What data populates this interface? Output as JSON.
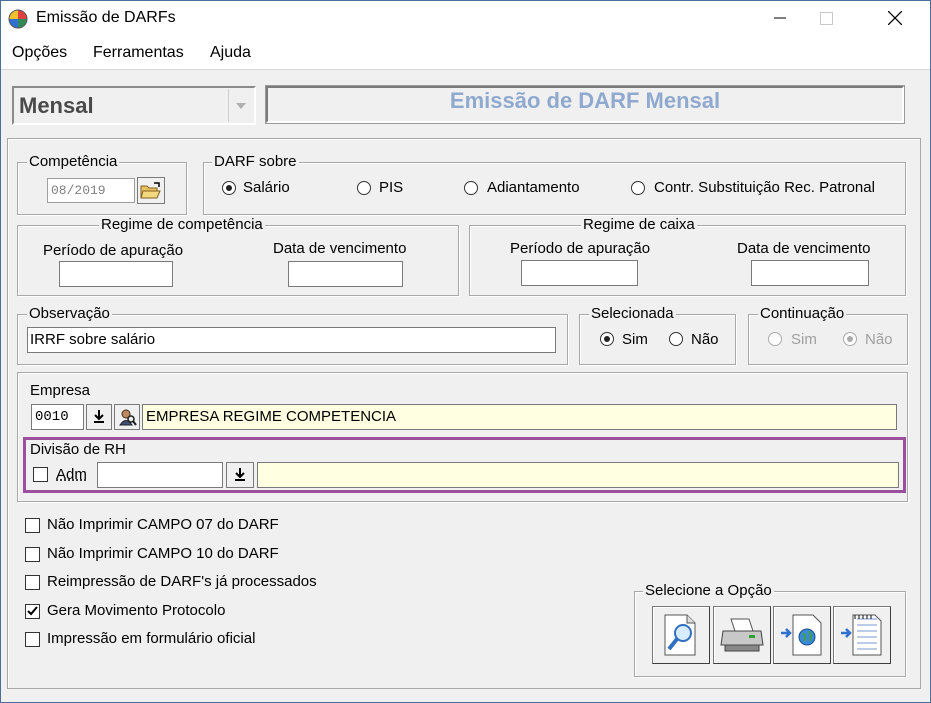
{
  "window": {
    "title": "Emissão de DARFs",
    "minimize_icon": "minimize-icon",
    "maximize_icon": "maximize-icon",
    "close_icon": "close-icon"
  },
  "menu": [
    "Opções",
    "Ferramentas",
    "Ajuda"
  ],
  "header": {
    "type_value": "Mensal",
    "title": "Emissão de DARF Mensal"
  },
  "competencia": {
    "label": "Competência",
    "value": "08/2019"
  },
  "darf_sobre": {
    "label": "DARF sobre",
    "options": [
      "Salário",
      "PIS",
      "Adiantamento",
      "Contr. Substituição Rec. Patronal"
    ],
    "selected": "Salário"
  },
  "regime_competencia": {
    "label": "Regime de competência",
    "periodo_label": "Período de apuração",
    "periodo_value": "",
    "vencimento_label": "Data de vencimento",
    "vencimento_value": ""
  },
  "regime_caixa": {
    "label": "Regime de caixa",
    "periodo_label": "Período de apuração",
    "periodo_value": "",
    "vencimento_label": "Data de vencimento",
    "vencimento_value": ""
  },
  "observacao": {
    "label": "Observação",
    "value": "IRRF sobre salário"
  },
  "selecionada": {
    "label": "Selecionada",
    "options": [
      "Sim",
      "Não"
    ],
    "selected": "Sim"
  },
  "continuacao": {
    "label": "Continuação",
    "options": [
      "Sim",
      "Não"
    ],
    "selected": "Não"
  },
  "empresa": {
    "label": "Empresa",
    "code": "0010",
    "name": "EMPRESA REGIME COMPETENCIA"
  },
  "divisao": {
    "label": "Divisão de RH",
    "adm_label": "Adm",
    "adm_checked": false,
    "code": "",
    "name": ""
  },
  "options": [
    {
      "label": "Não Imprimir CAMPO 07 do DARF",
      "checked": false
    },
    {
      "label": "Não Imprimir CAMPO 10 do DARF",
      "checked": false
    },
    {
      "label": "Reimpressão de DARF's já processados",
      "checked": false
    },
    {
      "label": "Gera Movimento Protocolo",
      "checked": true
    },
    {
      "label": "Impressão em formulário oficial",
      "checked": false
    }
  ],
  "selecione": {
    "label": "Selecione a Opção",
    "buttons": [
      "preview-icon",
      "printer-icon",
      "export-web-icon",
      "export-file-icon"
    ]
  },
  "colors": {
    "header_title": "#8fa9cf",
    "highlight_border": "#9b4f9f",
    "field_yellow": "#ffffe1"
  }
}
